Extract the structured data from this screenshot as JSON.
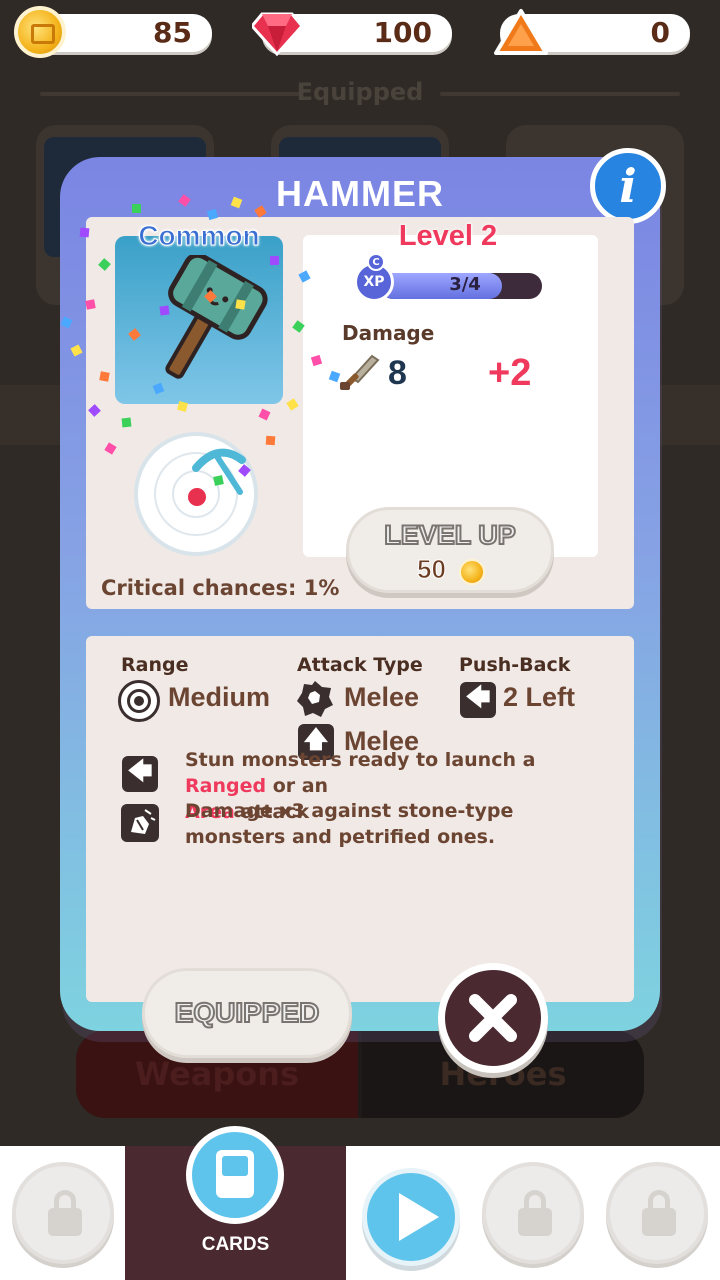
{
  "currency": {
    "coins": "85",
    "gems": "100",
    "tokens": "0"
  },
  "background": {
    "equipped_label": "Equipped",
    "tab_weapons": "Weapons",
    "tab_heroes": "Heroes"
  },
  "modal": {
    "title": "HAMMER",
    "info_symbol": "i",
    "rarity": "Common",
    "level": "Level 2",
    "xp_badge": "XP",
    "xp_badge_tier": "C",
    "xp_progress_text": "3/4",
    "xp_progress_fraction": 0.75,
    "damage_label": "Damage",
    "damage_value": "8",
    "damage_bonus": "+2",
    "critical_text": "Critical chances: 1%",
    "level_up_label": "LEVEL UP",
    "level_up_cost": "50",
    "attributes": {
      "range_head": "Range",
      "range_value": "Medium",
      "attack_head": "Attack Type",
      "attack_value_1": "Melee",
      "attack_value_2": "Melee",
      "push_head": "Push-Back",
      "push_value": "2 Left"
    },
    "ability_1": {
      "part1": "Stun monsters ready to launch a ",
      "hl1": "Ranged",
      "part2": " or an ",
      "hl2": "Area",
      "part3": " attack"
    },
    "ability_2": "Damage x3 against stone-type monsters and petrified ones.",
    "equipped_label": "EQUIPPED",
    "close_symbol": "×"
  },
  "nav": {
    "cards_label": "CARDS"
  },
  "colors": {
    "accent_red": "#ef3a5d",
    "accent_blue": "#5fc4ec",
    "dark_brown": "#4a2a30"
  }
}
